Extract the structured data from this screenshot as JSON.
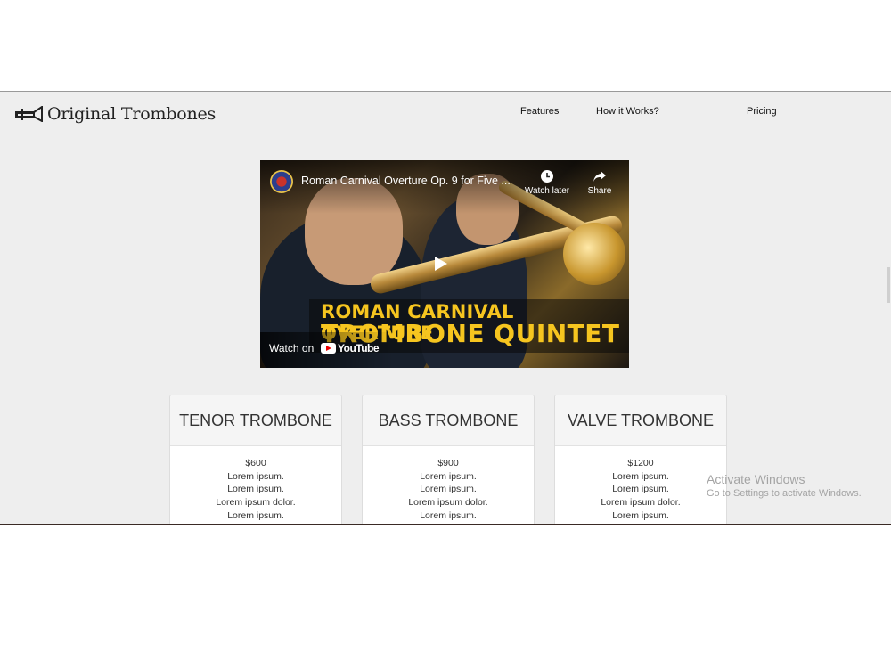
{
  "brand": {
    "name": "Original Trombones",
    "logo_icon": "trombone-icon"
  },
  "nav": {
    "features": "Features",
    "how_it_works": "How it Works?",
    "pricing": "Pricing"
  },
  "video": {
    "title": "Roman Carnival Overture Op. 9 for Five ...",
    "watch_later": "Watch later",
    "share": "Share",
    "caption_line1": "ROMAN CARNIVAL OVERTURE",
    "caption_line2": "TROMBONE QUINTET",
    "watch_on": "Watch on",
    "youtube": "YouTube"
  },
  "cards": [
    {
      "title": "TENOR TROMBONE",
      "price": "$600",
      "features": [
        "Lorem ipsum.",
        "Lorem ipsum.",
        "Lorem ipsum dolor.",
        "Lorem ipsum."
      ]
    },
    {
      "title": "BASS TROMBONE",
      "price": "$900",
      "features": [
        "Lorem ipsum.",
        "Lorem ipsum.",
        "Lorem ipsum dolor.",
        "Lorem ipsum."
      ]
    },
    {
      "title": "VALVE TROMBONE",
      "price": "$1200",
      "features": [
        "Lorem ipsum.",
        "Lorem ipsum.",
        "Lorem ipsum dolor.",
        "Lorem ipsum."
      ]
    }
  ],
  "watermark": {
    "line1": "Activate Windows",
    "line2": "Go to Settings to activate Windows."
  },
  "colors": {
    "page_bg": "#eeeeee",
    "caption_yellow": "#f6c51f"
  }
}
